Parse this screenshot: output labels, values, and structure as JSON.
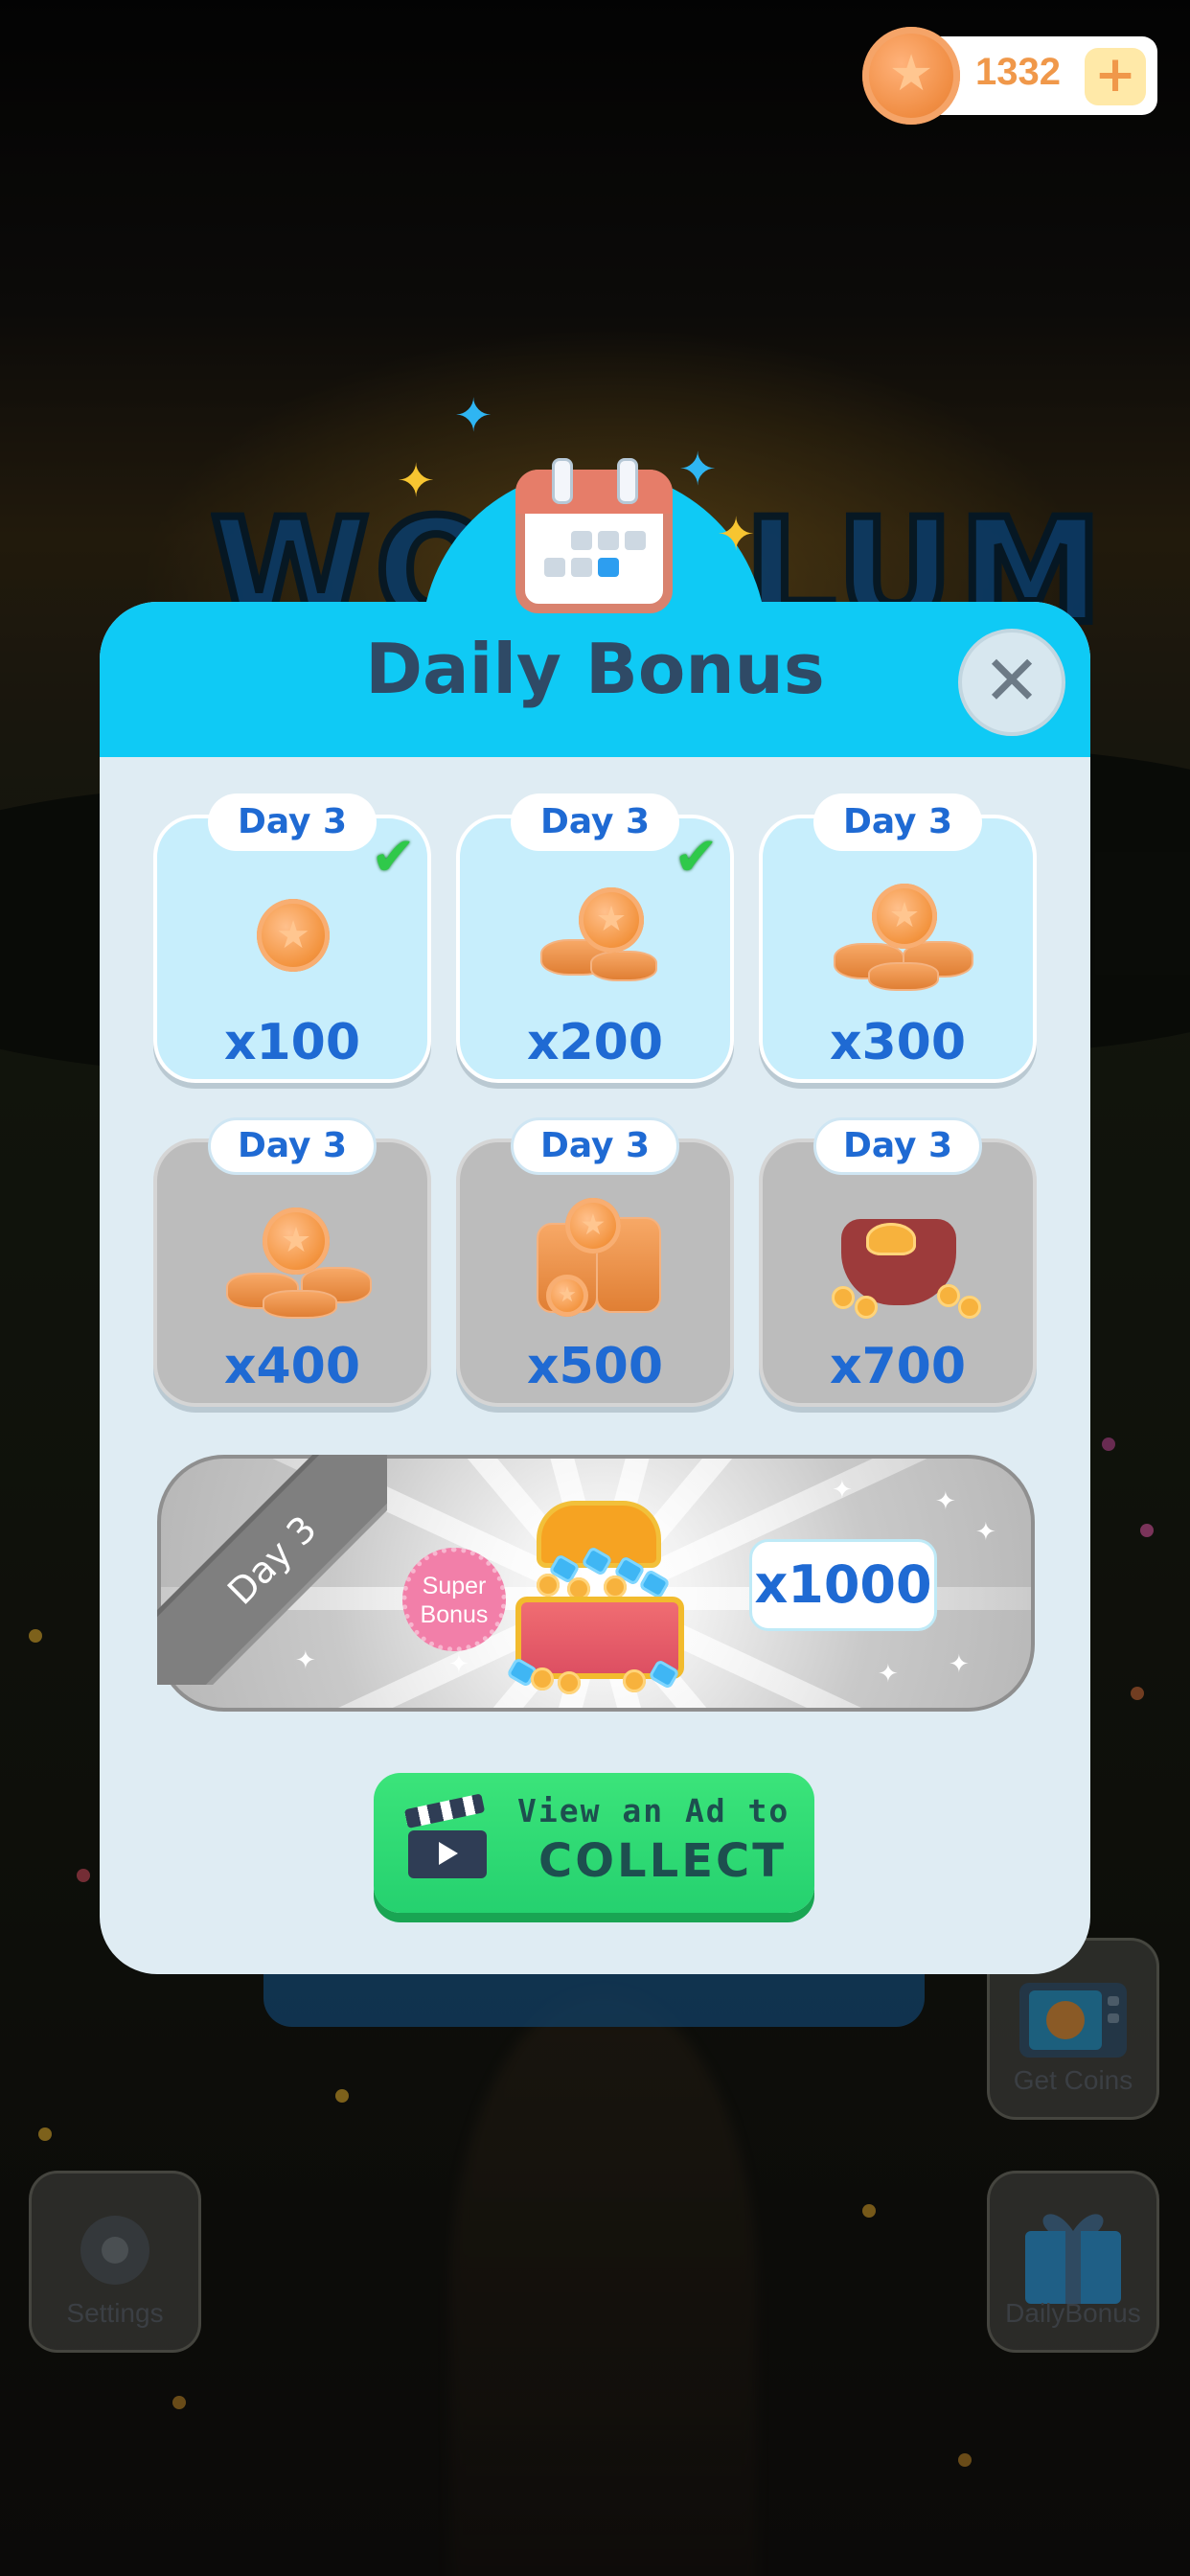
{
  "coin_bar": {
    "count": "1332",
    "plus_icon": "+",
    "coin_icon": "coin-icon"
  },
  "background": {
    "logo_text": "WORDLUM",
    "get_coins_label": "Get Coins",
    "settings_label": "Settings",
    "daily_bonus_label": "DailyBonus"
  },
  "modal": {
    "title": "Daily Bonus",
    "close_symbol": "✕",
    "days": [
      {
        "label": "Day 3",
        "amount": "x100",
        "state": "claimed"
      },
      {
        "label": "Day 3",
        "amount": "x200",
        "state": "claimed"
      },
      {
        "label": "Day 3",
        "amount": "x300",
        "state": "available"
      },
      {
        "label": "Day 3",
        "amount": "x400",
        "state": "locked"
      },
      {
        "label": "Day 3",
        "amount": "x500",
        "state": "locked"
      },
      {
        "label": "Day 3",
        "amount": "x700",
        "state": "locked"
      }
    ],
    "super_bonus": {
      "ribbon_label": "Day 3",
      "badge_line1": "Super",
      "badge_line2": "Bonus",
      "amount": "x1000"
    },
    "collect": {
      "line1": "View an Ad to",
      "line2": "COLLECT"
    }
  },
  "colors": {
    "header": "#0fcaf5",
    "accent_blue": "#1f6ad3",
    "collect_green": "#25d16f",
    "coin_orange": "#f3943f"
  }
}
